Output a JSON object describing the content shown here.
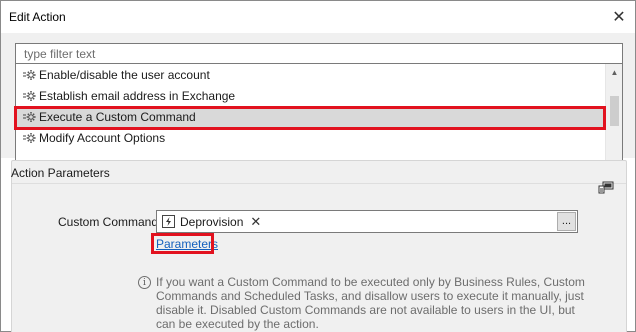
{
  "window": {
    "title": "Edit Action",
    "close_glyph": "✕"
  },
  "filter": {
    "placeholder": "type filter text",
    "value": ""
  },
  "actions_list": {
    "items": [
      {
        "label": "Enable/disable the user account",
        "icon": "gear-icon",
        "selected": false
      },
      {
        "label": "Establish email address in Exchange",
        "icon": "gear-icon",
        "selected": false
      },
      {
        "label": "Execute a Custom Command",
        "icon": "gear-icon",
        "selected": true
      },
      {
        "label": "Modify Account Options",
        "icon": "gear-icon",
        "selected": false
      }
    ],
    "scroll_up_glyph": "▲",
    "scroll_down_glyph": "▼"
  },
  "action_parameters": {
    "header": "Action Parameters",
    "custom_command_label": "Custom Command:",
    "selected_command": "Deprovision",
    "chip_remove_glyph": "✕",
    "browse_label": "...",
    "parameters_link": "Parameters",
    "info_icon_glyph": "i",
    "info_text": "If you want a Custom Command to be executed only by Business Rules, Custom Commands and Scheduled Tasks, and disallow users to execute it manually, just disable it. Disabled Custom Commands are not available to users in the UI, but can be executed by the action."
  },
  "colors": {
    "highlight_red": "#e2121f",
    "link_blue": "#1560bd",
    "selected_row": "#d9d9d9",
    "panel_bg": "#f0f0f0"
  }
}
